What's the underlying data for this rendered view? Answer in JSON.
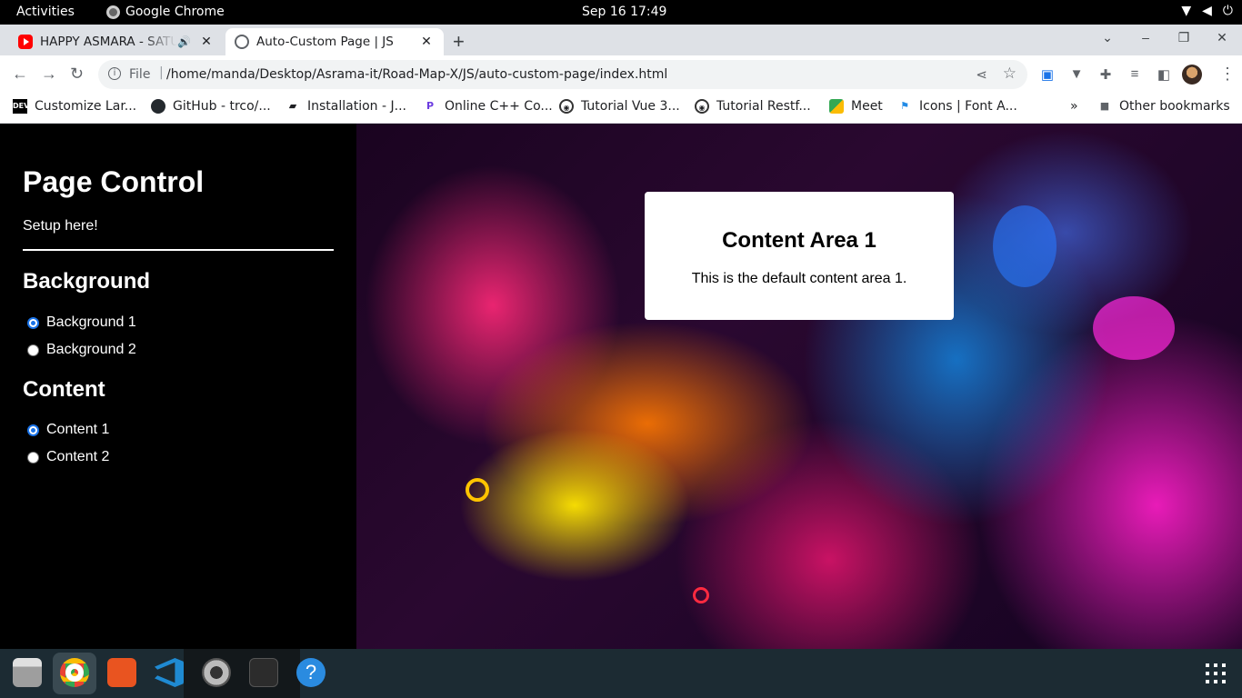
{
  "topbar": {
    "activities": "Activities",
    "app_name": "Google Chrome",
    "clock": "Sep 16  17:49",
    "tray_icons": [
      "wifi-icon",
      "volume-icon",
      "power-icon"
    ]
  },
  "tabs": [
    {
      "title": "HAPPY ASMARA - SATU",
      "favicon": "youtube-icon",
      "audio": true,
      "active": false
    },
    {
      "title": "Auto-Custom Page | JS",
      "favicon": "globe-icon",
      "active": true
    }
  ],
  "toolbar": {
    "scheme": "File",
    "url": "/home/manda/Desktop/Asrama-it/Road-Map-X/JS/auto-custom-page/index.html"
  },
  "bookmarks": {
    "items": [
      {
        "label": "Customize Lar...",
        "icon": "dev-icon"
      },
      {
        "label": "GitHub - trco/...",
        "icon": "github-icon"
      },
      {
        "label": "Installation - J...",
        "icon": "book-icon"
      },
      {
        "label": "Online C++ Co...",
        "icon": "compiler-icon"
      },
      {
        "label": "Tutorial Vue 3...",
        "icon": "site-icon"
      },
      {
        "label": "Tutorial Restf...",
        "icon": "site-icon"
      },
      {
        "label": "Meet",
        "icon": "meet-icon"
      },
      {
        "label": "Icons | Font A...",
        "icon": "flag-icon"
      }
    ],
    "overflow": "»",
    "other": "Other bookmarks"
  },
  "sidebar": {
    "title": "Page Control",
    "subtitle": "Setup here!",
    "background_heading": "Background",
    "background_options": [
      {
        "label": "Background 1",
        "checked": true
      },
      {
        "label": "Background 2",
        "checked": false
      }
    ],
    "content_heading": "Content",
    "content_options": [
      {
        "label": "Content 1",
        "checked": true
      },
      {
        "label": "Content 2",
        "checked": false
      }
    ]
  },
  "card": {
    "title": "Content Area 1",
    "text": "This is the default content area 1."
  },
  "dock": {
    "apps": [
      "files-icon",
      "chrome-icon",
      "software-icon",
      "vscode-icon",
      "settings-icon",
      "terminal-icon",
      "help-icon"
    ]
  },
  "colors": {
    "radio_accent": "#1a73e8",
    "dock_bg": "#1c2b33"
  }
}
